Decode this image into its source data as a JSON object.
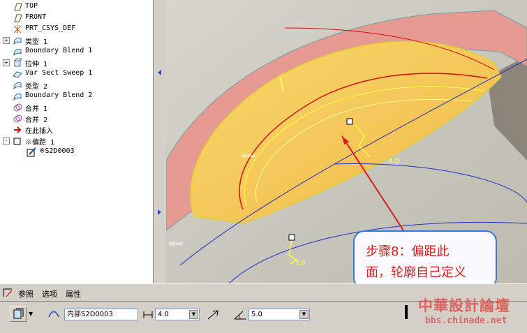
{
  "tree": {
    "items": [
      {
        "label": "TOP",
        "icon": "datum-plane-icon",
        "indent": 1,
        "expand": ""
      },
      {
        "label": "FRONT",
        "icon": "datum-plane-icon",
        "indent": 1,
        "expand": ""
      },
      {
        "label": "PRT_CSYS_DEF",
        "icon": "csys-icon",
        "indent": 1,
        "expand": ""
      },
      {
        "label": "类型 1",
        "icon": "surface-icon",
        "indent": 1,
        "expand": "+"
      },
      {
        "label": "Boundary Blend 1",
        "icon": "surface-icon",
        "indent": 1,
        "expand": ""
      },
      {
        "label": "拉伸 1",
        "icon": "extrude-icon",
        "indent": 1,
        "expand": "+"
      },
      {
        "label": "Var Sect Sweep 1",
        "icon": "sweep-icon",
        "indent": 1,
        "expand": ""
      },
      {
        "label": "类型 2",
        "icon": "surface-icon",
        "indent": 1,
        "expand": ""
      },
      {
        "label": "Boundary Blend 2",
        "icon": "surface-icon",
        "indent": 1,
        "expand": ""
      },
      {
        "label": "合并 1",
        "icon": "merge-icon",
        "indent": 1,
        "expand": ""
      },
      {
        "label": "合并 2",
        "icon": "merge-icon",
        "indent": 1,
        "expand": ""
      },
      {
        "label": "在此插入",
        "icon": "insert-arrow-icon",
        "indent": 1,
        "expand": ""
      },
      {
        "label": "※偏距 1",
        "icon": "offset-icon",
        "indent": 1,
        "expand": "-"
      },
      {
        "label": "※S2D0003",
        "icon": "sketch-icon",
        "indent": 2,
        "expand": ""
      }
    ]
  },
  "viewport": {
    "dim_value": "4.0",
    "dim_value_2": "5.0",
    "small_label": "偏距曲面",
    "bottom_label": "偏距曲面"
  },
  "callout": {
    "line1_prefix": "步骤",
    "line1_num": "8",
    "line1_suffix": "：偏距此",
    "line2": "面，轮廓自己定义"
  },
  "dashboard": {
    "tabs": [
      "参照",
      "选项",
      "属性"
    ],
    "ref_field": "内部S2D0003",
    "offset_value": "4.0",
    "angle_value": "5.0"
  },
  "watermark": {
    "title": "中華設計論壇",
    "url": "bbs.chinade.net"
  },
  "colors": {
    "surface_yellow": "#f2c64a",
    "surface_pink": "#e89090",
    "edge_red": "#d01010",
    "curve_blue": "#2030c0",
    "callout_border": "#3a78d6"
  }
}
